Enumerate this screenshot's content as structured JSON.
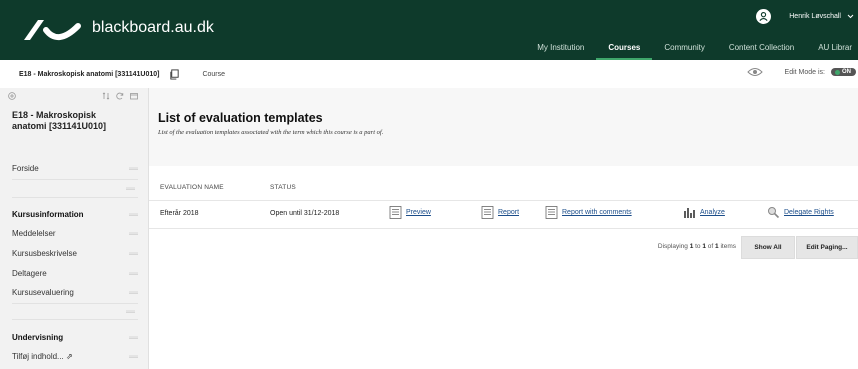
{
  "header": {
    "site_name": "blackboard.au.dk",
    "user_name": "Henrik Løvschall",
    "nav": [
      "My Institution",
      "Courses",
      "Community",
      "Content Collection",
      "AU Librar"
    ],
    "active_nav": "Courses",
    "brand_color": "#0e3a2b",
    "accent_color": "#3fa66b"
  },
  "breadcrumb": {
    "course": "E18 - Makroskopisk anatomi [331141U010]",
    "current": "Course",
    "edit_mode_label": "Edit Mode is:",
    "edit_mode_value": "ON"
  },
  "sidebar": {
    "course_title": "E18 - Makroskopisk anatomi [331141U010]",
    "items": [
      {
        "label": "Forside",
        "bold": false
      },
      {
        "label": "Kursusinformation",
        "bold": true
      },
      {
        "label": "Meddelelser",
        "bold": false
      },
      {
        "label": "Kursusbeskrivelse",
        "bold": false
      },
      {
        "label": "Deltagere",
        "bold": false
      },
      {
        "label": "Kursusevaluering",
        "bold": false
      },
      {
        "label": "Undervisning",
        "bold": true
      },
      {
        "label": "Tilføj indhold... ⇗",
        "bold": false
      }
    ]
  },
  "page": {
    "title": "List of evaluation templates",
    "subtitle": "List of the evaluation templates associated with the term which this course is a part of.",
    "columns": [
      "EVALUATION NAME",
      "STATUS"
    ],
    "rows": [
      {
        "name": "Efterår 2018",
        "status": "Open until 31/12-2018",
        "actions": [
          "Preview",
          "Report",
          "Report with comments",
          "Analyze",
          "Delegate Rights"
        ]
      }
    ],
    "paging": {
      "prefix": "Displaying ",
      "from": "1",
      "mid": " to ",
      "to": "1",
      "of": " of ",
      "total": "1",
      "suffix": " items"
    },
    "show_all": "Show All",
    "edit_paging": "Edit Paging..."
  }
}
